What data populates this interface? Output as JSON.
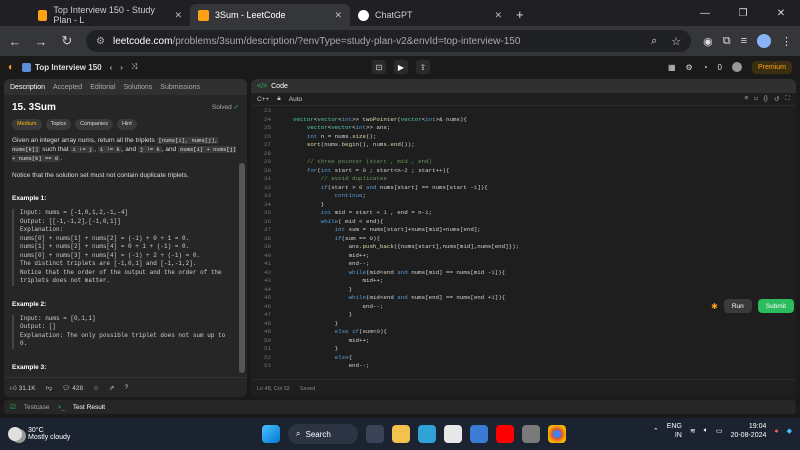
{
  "browser": {
    "tabs": [
      {
        "title": "Top Interview 150 - Study Plan - L",
        "active": false,
        "favicon_color": "#ffa116"
      },
      {
        "title": "3Sum - LeetCode",
        "active": true,
        "favicon_color": "#ffa116"
      },
      {
        "title": "ChatGPT",
        "active": false,
        "favicon_color": "#ffffff"
      }
    ],
    "url_domain": "leetcode.com",
    "url_path": "/problems/3sum/description/?envType=study-plan-v2&envId=top-interview-150"
  },
  "lc_nav": {
    "list_title": "Top Interview 150",
    "streak": "0",
    "premium": "Premium"
  },
  "left_tabs": [
    "Description",
    "Accepted",
    "Editorial",
    "Solutions",
    "Submissions"
  ],
  "problem": {
    "title": "15. 3Sum",
    "status": "Solved",
    "chips": [
      "Medium",
      "Topics",
      "Companies",
      "Hint"
    ],
    "desc_1": "Given an integer array nums, return all the triplets",
    "desc_code_1": "[nums[i], nums[j], nums[k]]",
    "desc_2": "such that",
    "desc_code_2": "i != j",
    "desc_code_3": "i != k",
    "desc_3": "and",
    "desc_code_4": "j != k",
    "desc_4": ", and",
    "desc_code_5": "nums[i] + nums[j] + nums[k] == 0",
    "notice": "Notice that the solution set must not contain duplicate triplets.",
    "ex1_title": "Example 1:",
    "ex1_body": "Input: nums = [-1,0,1,2,-1,-4]\nOutput: [[-1,-1,2],[-1,0,1]]\nExplanation:\nnums[0] + nums[1] + nums[2] = (-1) + 0 + 1 = 0.\nnums[1] + nums[2] + nums[4] = 0 + 1 + (-1) = 0.\nnums[0] + nums[3] + nums[4] = (-1) + 2 + (-1) = 0.\nThe distinct triplets are [-1,0,1] and [-1,-1,2].\nNotice that the order of the output and the order of the\ntriplets does not matter.",
    "ex2_title": "Example 2:",
    "ex2_body": "Input: nums = [0,1,1]\nOutput: []\nExplanation: The only possible triplet does not sum up to\n0.",
    "ex3_title": "Example 3:",
    "likes": "31.1K",
    "comments": "428"
  },
  "editor": {
    "header": "Code",
    "language": "C++",
    "mode": "Auto",
    "status": "Ln 48, Col 32",
    "saved": "Saved",
    "lines": [
      {
        "n": "23",
        "t": ""
      },
      {
        "n": "24",
        "t": "    vector<vector<int>> twoPointer(vector<int>& nums){"
      },
      {
        "n": "25",
        "t": "        vector<vector<int>> ans;"
      },
      {
        "n": "26",
        "t": "        int n = nums.size();"
      },
      {
        "n": "27",
        "t": "        sort(nums.begin(), nums.end());"
      },
      {
        "n": "28",
        "t": ""
      },
      {
        "n": "29",
        "t": "        // three pointer (start , mid , end)"
      },
      {
        "n": "30",
        "t": "        for(int start = 0 ; start<n-2 ; start++){"
      },
      {
        "n": "31",
        "t": "            // avoid duplicates"
      },
      {
        "n": "32",
        "t": "            if(start > 0 and nums[start] == nums[start -1]){"
      },
      {
        "n": "33",
        "t": "                continue;"
      },
      {
        "n": "34",
        "t": "            }"
      },
      {
        "n": "35",
        "t": "            int mid = start + 1 , end = n-1;"
      },
      {
        "n": "36",
        "t": "            while( mid < end){"
      },
      {
        "n": "37",
        "t": "                int sum = nums[start]+nums[mid]+nums[end];"
      },
      {
        "n": "38",
        "t": "                if(sum == 0){"
      },
      {
        "n": "39",
        "t": "                    ans.push_back({nums[start],nums[mid],nums[end]});"
      },
      {
        "n": "40",
        "t": "                    mid++;"
      },
      {
        "n": "41",
        "t": "                    end--;"
      },
      {
        "n": "42",
        "t": "                    while(mid<end and nums[mid] == nums[mid -1]){"
      },
      {
        "n": "43",
        "t": "                        mid++;"
      },
      {
        "n": "44",
        "t": "                    }"
      },
      {
        "n": "45",
        "t": "                    while(mid<end and nums[end] == nums[end +1]){"
      },
      {
        "n": "46",
        "t": "                        end--;"
      },
      {
        "n": "47",
        "t": "                    }"
      },
      {
        "n": "48",
        "t": "                }"
      },
      {
        "n": "49",
        "t": "                else if(sum<0){"
      },
      {
        "n": "50",
        "t": "                    mid++;"
      },
      {
        "n": "51",
        "t": "                }"
      },
      {
        "n": "52",
        "t": "                else{"
      },
      {
        "n": "53",
        "t": "                    end--;"
      },
      {
        "n": "54",
        "t": "                }"
      },
      {
        "n": "55",
        "t": "            }"
      },
      {
        "n": "56",
        "t": "        }"
      }
    ],
    "run": "Run",
    "submit": "Submit"
  },
  "testbar": {
    "testcase": "Testcase",
    "result": "Test Result"
  },
  "taskbar": {
    "temp": "30°C",
    "weather": "Mostly cloudy",
    "search": "Search",
    "lang": "ENG",
    "region": "IN",
    "time": "19:04",
    "date": "20-08-2024"
  }
}
